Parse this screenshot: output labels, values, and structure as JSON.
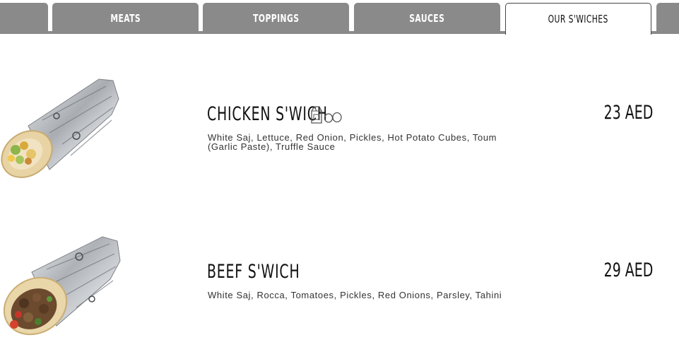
{
  "tabs": [
    {
      "label": "Meats"
    },
    {
      "label": "Toppings"
    },
    {
      "label": "Sauces"
    },
    {
      "label": "Our S'wiches",
      "active": true
    }
  ],
  "items": [
    {
      "name": "Chicken S'wich",
      "description": "White Saj, Lettuce, Red Onion, Pickles, Hot Potato Cubes, Toum (Garlic Paste), Truffle Sauce",
      "price": "23 AED",
      "allergen_icons": [
        "milk-carton-icon",
        "eggs-icon"
      ]
    },
    {
      "name": "Beef S'wich",
      "description": "White Saj, Rocca, Tomatoes, Pickles, Red Onions, Parsley, Tahini",
      "price": "29 AED",
      "allergen_icons": []
    }
  ],
  "colors": {
    "tab_inactive": "#8a8a8a",
    "tab_active": "#ffffff",
    "foil": "#b9bcc0"
  }
}
